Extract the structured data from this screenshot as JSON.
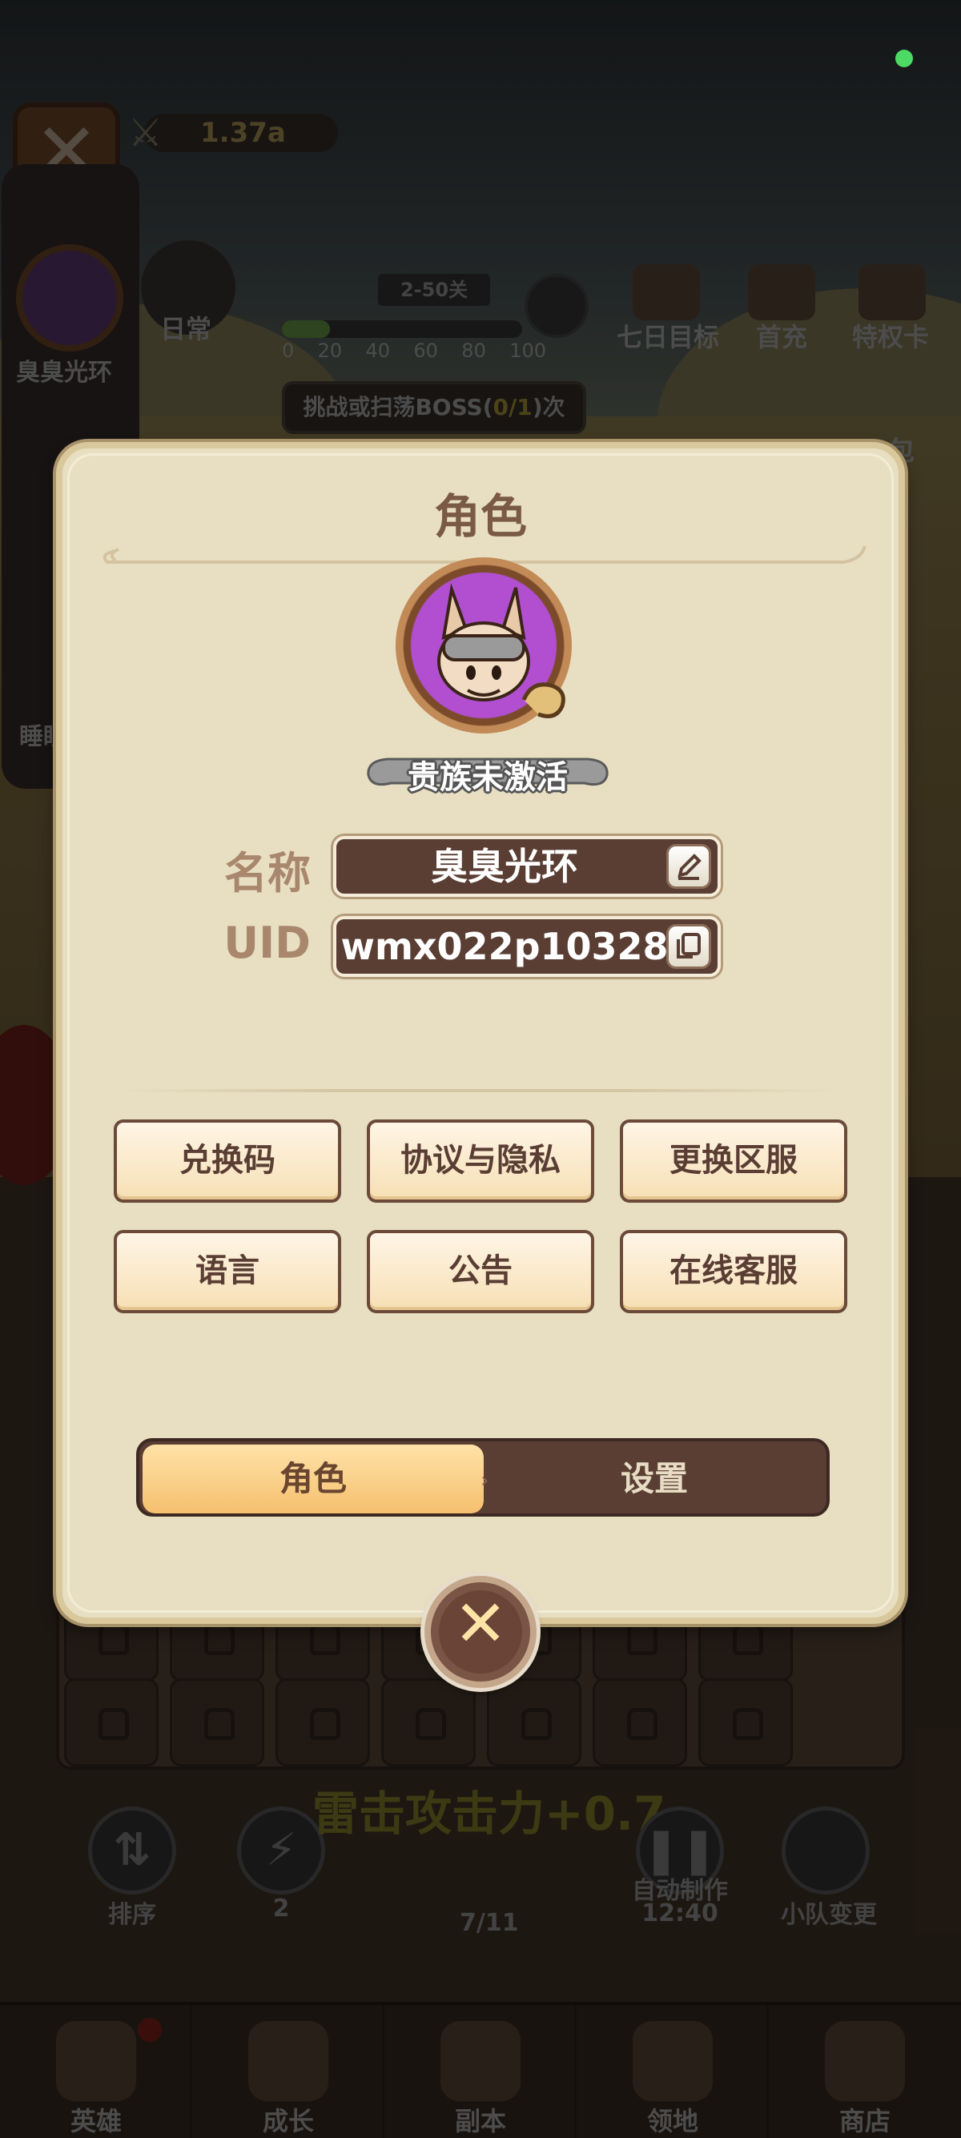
{
  "background": {
    "power_value": "1.37a",
    "sidebar": {
      "player_name": "臭臭光环",
      "sleep_label": "睡眠"
    },
    "daily_label": "日常",
    "stage_badge": "2-50关",
    "stage_progress": 0.2,
    "progress_ticks": [
      "0",
      "20",
      "40",
      "60",
      "80",
      "100"
    ],
    "top_icons": [
      "七日目标",
      "首充",
      "特权卡"
    ],
    "boss_bar": {
      "prefix": "挑战或扫荡BOSS(",
      "count": "0/1",
      "suffix": ")次"
    },
    "pack_label": "包",
    "actions": {
      "sort": "排序",
      "energy_count": "2",
      "auto_craft": "自动制作",
      "auto_craft_timer": "12:40",
      "squad_change": "小队变更",
      "craft_progress": "7/11"
    },
    "lightning_bonus": "雷击攻击力+0.7",
    "bottom_nav": [
      "英雄",
      "成长",
      "副本",
      "领地",
      "商店"
    ]
  },
  "dialog": {
    "title": "角色",
    "noble_status": "贵族未激活",
    "name_label": "名称",
    "name_value": "臭臭光环",
    "uid_label": "UID",
    "uid_value": "wmx022p10328",
    "menu_buttons": [
      "兑换码",
      "协议与隐私",
      "更换区服",
      "语言",
      "公告",
      "在线客服"
    ],
    "tabs": {
      "active": "角色",
      "inactive": "设置"
    }
  },
  "colors": {
    "accent_tab": "#f5c06e",
    "panel_bg": "#e8dfc3",
    "field_bg": "#5a3e34",
    "status_dot": "#4cd964"
  },
  "icons": [
    "close-icon",
    "edit-icon",
    "copy-icon",
    "lock-icon",
    "swords-icon"
  ]
}
